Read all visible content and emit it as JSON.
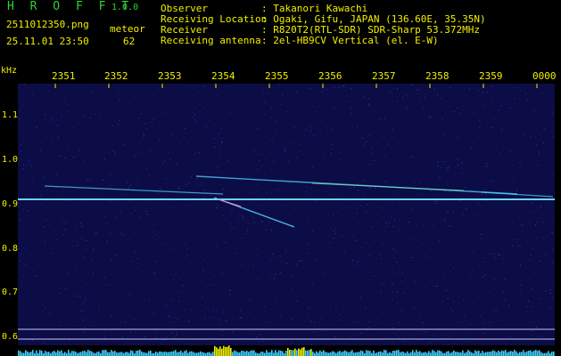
{
  "header": {
    "app_title": "H R O F F T",
    "app_version": "1.0.0",
    "file_name": "2511012350.png",
    "timestamp": "25.11.01 23:50",
    "meteor_label": "meteor",
    "meteor_count": "62",
    "info": [
      {
        "label": "Observer",
        "value": ": Takanori Kawachi"
      },
      {
        "label": "Receiving Location",
        "value": ": Ogaki, Gifu, JAPAN (136.60E, 35.35N)"
      },
      {
        "label": "Receiver",
        "value": ": R820T2(RTL-SDR) SDR-Sharp 53.372MHz"
      },
      {
        "label": "Receiving antenna",
        "value": ": 2el-HB9CV Vertical (el. E-W)"
      }
    ]
  },
  "waterfall": {
    "unit_label": "kHz",
    "time_ticks": [
      "2351",
      "2352",
      "2353",
      "2354",
      "2355",
      "2356",
      "2357",
      "2358",
      "2359",
      "0000"
    ],
    "freq_ticks": [
      "1.1",
      "1.0",
      "0.9",
      "0.8",
      "0.7",
      "0.6"
    ],
    "freq_range_khz": [
      0.58,
      1.17
    ],
    "carrier_khz": 0.91,
    "background_color": "#0c0c46",
    "trail_color": "#4fd6ff",
    "accent_color": "#f0f000"
  }
}
